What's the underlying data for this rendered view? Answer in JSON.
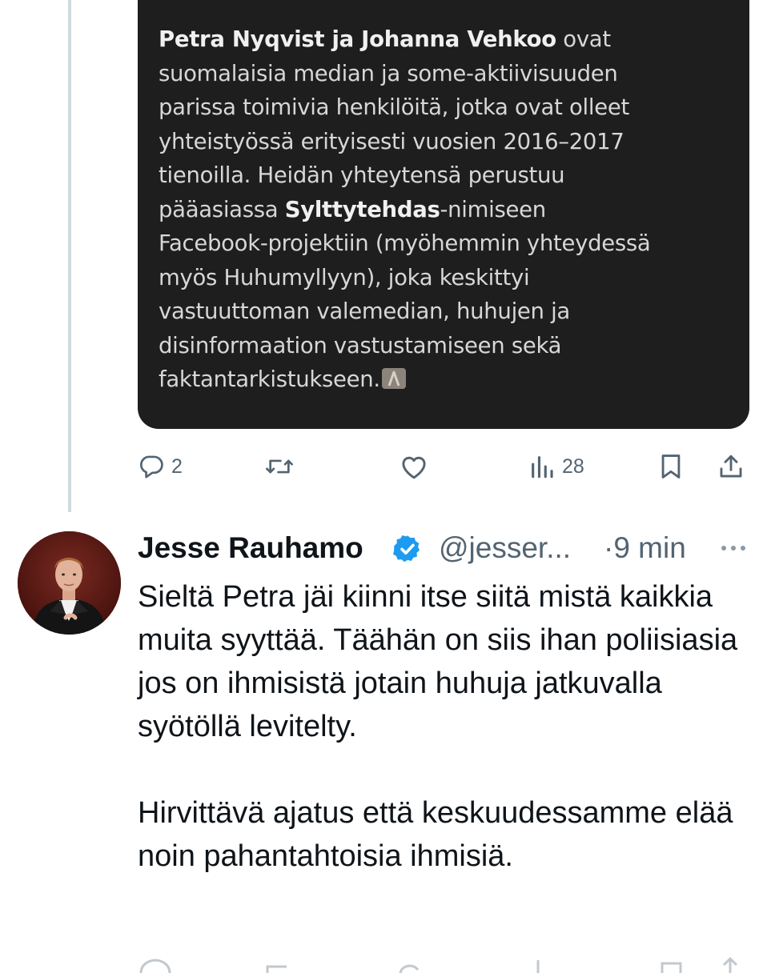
{
  "quoted_card": {
    "lines": [
      [
        {
          "b": true,
          "t": "Petra Nyqvist ja Johanna Vehkoo"
        },
        {
          "b": false,
          "t": " ovat"
        }
      ],
      [
        {
          "b": false,
          "t": "suomalaisia median ja some-aktiivisuuden"
        }
      ],
      [
        {
          "b": false,
          "t": "parissa toimivia henkilöitä, jotka ovat olleet"
        }
      ],
      [
        {
          "b": false,
          "t": "yhteistyössä erityisesti vuosien 2016–2017"
        }
      ],
      [
        {
          "b": false,
          "t": "tienoilla. Heidän yhteytensä perustuu"
        }
      ],
      [
        {
          "b": false,
          "t": "pääasiassa "
        },
        {
          "b": true,
          "t": "Sylttytehdas"
        },
        {
          "b": false,
          "t": "-nimiseen"
        }
      ],
      [
        {
          "b": false,
          "t": "Facebook-projektiin (myöhemmin yhteydessä"
        }
      ],
      [
        {
          "b": false,
          "t": "myös Huhumyllyyn), joka keskittyi"
        }
      ],
      [
        {
          "b": false,
          "t": "vastuuttoman valemedian, huhujen ja"
        }
      ],
      [
        {
          "b": false,
          "t": "disinformaation vastustamiseen sekä"
        }
      ],
      [
        {
          "b": false,
          "t": "faktantarkistukseen."
        }
      ]
    ]
  },
  "previous_tweet_actions": {
    "reply_count": "2",
    "views_count": "28"
  },
  "tweet": {
    "author_name": "Jesse Rauhamo",
    "handle": "@jesser...",
    "timestamp": "·9 min",
    "paragraphs": [
      "Sieltä Petra jäi kiinni itse siitä mistä kaikkia muita syyttää. Täähän on siis ihan poliisiasia jos on ihmisistä jotain huhuja jatkuvalla syötöllä levitelty.",
      "Hirvittävä ajatus että keskuudessamme elää noin pahantahtoisia ihmisiä."
    ]
  },
  "icons": [
    "reply-icon",
    "retweet-icon",
    "like-icon",
    "views-icon",
    "bookmark-icon",
    "share-icon",
    "verified-badge-icon",
    "more-icon"
  ],
  "colors": {
    "card_background": "#1e1e1e",
    "secondary_text": "#536471",
    "verified_blue": "#1d9bf0",
    "thread_line": "#cfd9de"
  }
}
